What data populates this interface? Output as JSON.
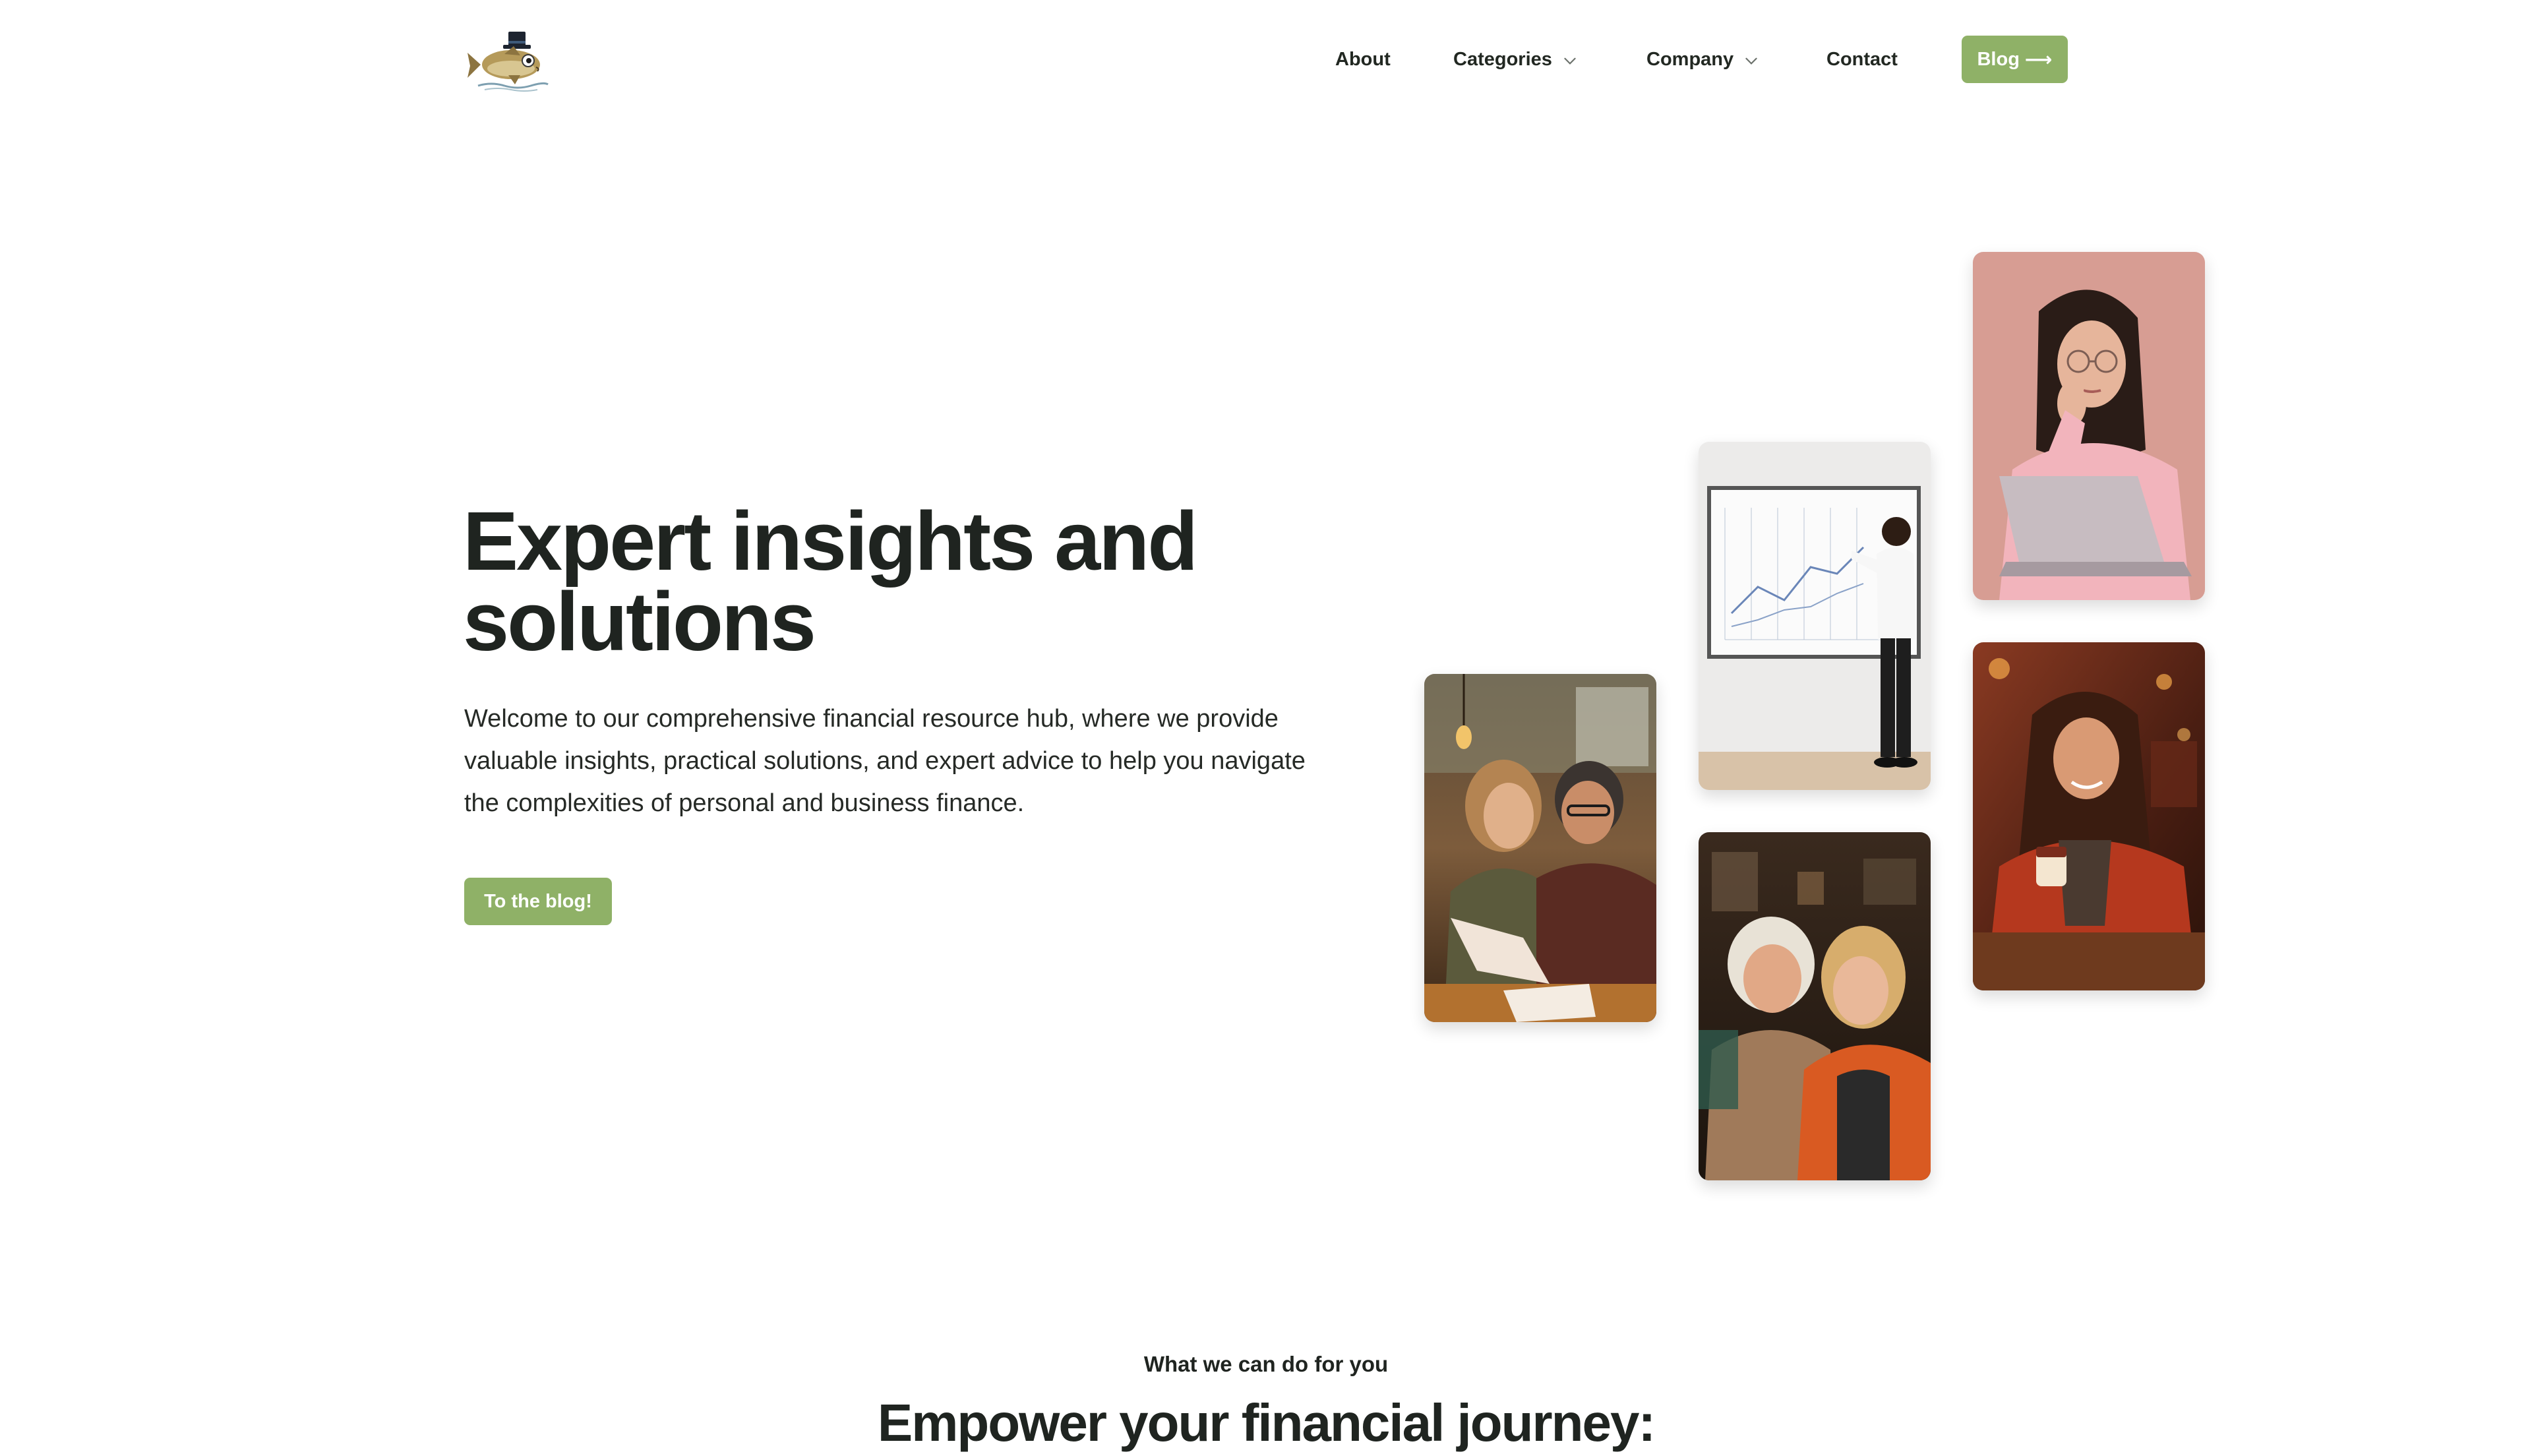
{
  "header": {
    "logo_icon": "fish-with-top-hat-logo",
    "nav": {
      "about": "About",
      "categories": "Categories",
      "company": "Company",
      "contact": "Contact",
      "blog": "Blog",
      "blog_arrow": "⟶"
    }
  },
  "hero": {
    "title": "Expert insights and solutions",
    "description": "Welcome to our comprehensive financial resource hub, where we provide valuable insights, practical solutions, and expert advice to help you navigate the complexities of personal and business finance.",
    "cta": "To the blog!"
  },
  "photos": [
    {
      "icon": "couple-reviewing-document-photo"
    },
    {
      "icon": "man-at-whiteboard-photo"
    },
    {
      "icon": "two-women-laughing-photo"
    },
    {
      "icon": "woman-with-laptop-photo"
    },
    {
      "icon": "woman-with-coffee-photo"
    }
  ],
  "section": {
    "eyebrow": "What we can do for you",
    "title": "Empower your financial journey:"
  },
  "colors": {
    "accent": "#8fb167",
    "text": "#1f2420",
    "background": "#ffffff"
  }
}
